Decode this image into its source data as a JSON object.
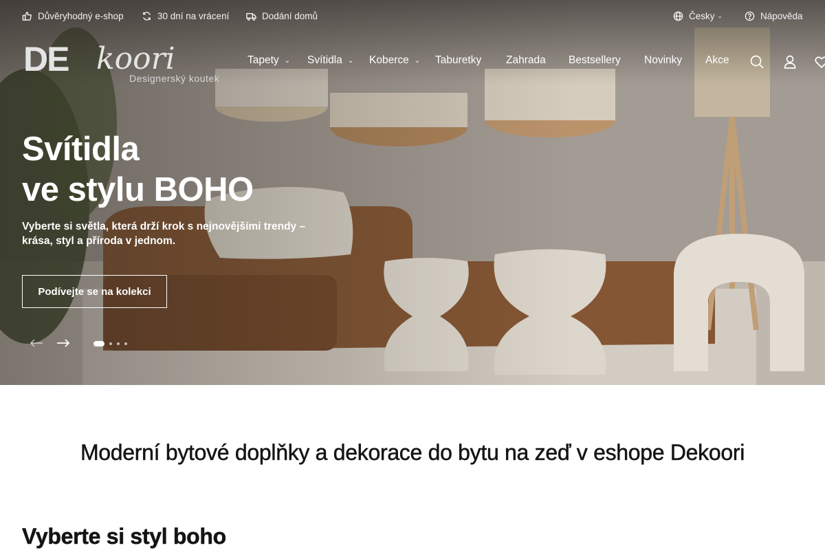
{
  "topbar": {
    "trusted": "Důvěryhodný e-shop",
    "returns": "30 dní na vrácení",
    "delivery": "Dodání domů",
    "language": "Česky",
    "help": "Nápověda"
  },
  "logo": {
    "wordmark_de": "DE",
    "wordmark_koori": "koori",
    "tagline": "Designerský koutek"
  },
  "nav": {
    "items": [
      {
        "label": "Tapety",
        "dropdown": true
      },
      {
        "label": "Svítidla",
        "dropdown": true
      },
      {
        "label": "Koberce",
        "dropdown": true
      },
      {
        "label": "Taburetky",
        "dropdown": false
      },
      {
        "label": "Zahrada",
        "dropdown": false
      },
      {
        "label": "Bestsellery",
        "dropdown": false
      },
      {
        "label": "Novinky",
        "dropdown": false
      },
      {
        "label": "Akce",
        "dropdown": false
      }
    ],
    "icons": [
      "search-icon",
      "user-icon",
      "heart-icon"
    ]
  },
  "hero": {
    "title_line1": "Svítidla",
    "title_line2": "ve stylu BOHO",
    "subtitle": "Vyberte si světla, která drží krok s nejnovějšími trendy – krása, styl a příroda v jednom.",
    "cta": "Podívejte se na kolekci",
    "slides_total": 4,
    "active_slide": 1
  },
  "content": {
    "heading": "Moderní bytové doplňky a dekorace do bytu na zeď v eshope Dekoori",
    "subheading": "Vyberte si styl boho"
  },
  "colors": {
    "hero_text": "#ffffff",
    "heading_text": "#141414",
    "sofa": "#8a5a35"
  }
}
